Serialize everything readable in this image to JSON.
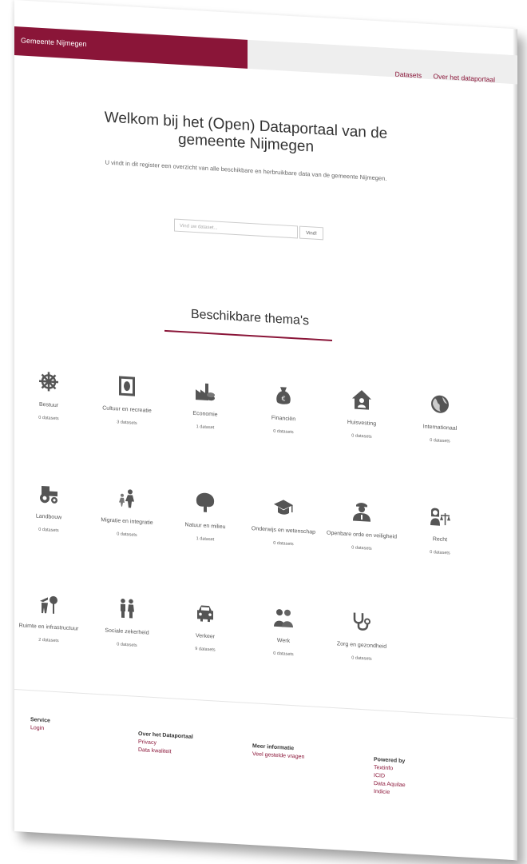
{
  "header": {
    "brand": "Gemeente Nijmegen",
    "nav": [
      "Datasets",
      "Over het dataportaal"
    ]
  },
  "hero": {
    "title": "Welkom bij het (Open) Dataportaal van de gemeente Nijmegen",
    "subtitle": "U vindt in dit register een overzicht van alle beschikbare en herbruikbare data van de gemeente Nijmegen.",
    "search_placeholder": "Vind uw dataset...",
    "search_button": "Vind!"
  },
  "themes": {
    "title": "Beschikbare thema's",
    "items": [
      {
        "label": "Bestuur",
        "count": "0 datasets",
        "icon": "ship-wheel-icon"
      },
      {
        "label": "Cultuur en recreatie",
        "count": "3 datasets",
        "icon": "painting-icon"
      },
      {
        "label": "Economie",
        "count": "1 dataset",
        "icon": "factory-coins-icon"
      },
      {
        "label": "Financiën",
        "count": "0 datasets",
        "icon": "money-bag-icon"
      },
      {
        "label": "Huisvesting",
        "count": "0 datasets",
        "icon": "house-icon"
      },
      {
        "label": "Internationaal",
        "count": "0 datasets",
        "icon": "globe-icon"
      },
      {
        "label": "Landbouw",
        "count": "0 datasets",
        "icon": "tractor-icon"
      },
      {
        "label": "Migratie en integratie",
        "count": "0 datasets",
        "icon": "migration-icon"
      },
      {
        "label": "Natuur en milieu",
        "count": "1 dataset",
        "icon": "tree-icon"
      },
      {
        "label": "Onderwijs en wetenschap",
        "count": "0 datasets",
        "icon": "graduation-cap-icon"
      },
      {
        "label": "Openbare orde en veiligheid",
        "count": "0 datasets",
        "icon": "police-officer-icon"
      },
      {
        "label": "Recht",
        "count": "0 datasets",
        "icon": "judge-scales-icon"
      },
      {
        "label": "Ruimte en infrastructuur",
        "count": "2 datasets",
        "icon": "construction-icon"
      },
      {
        "label": "Sociale zekerheid",
        "count": "0 datasets",
        "icon": "family-icon"
      },
      {
        "label": "Verkeer",
        "count": "9 datasets",
        "icon": "car-icon"
      },
      {
        "label": "Werk",
        "count": "0 datasets",
        "icon": "workers-icon"
      },
      {
        "label": "Zorg en gezondheid",
        "count": "0 datasets",
        "icon": "stethoscope-icon"
      }
    ]
  },
  "footer": {
    "service": {
      "heading": "Service",
      "links": [
        "Login"
      ]
    },
    "over": {
      "heading": "Over het Dataportaal",
      "links": [
        "Privacy",
        "Data kwaliteit"
      ]
    },
    "meer": {
      "heading": "Meer informatie",
      "links": [
        "Veel gestelde vragen"
      ]
    },
    "powered": {
      "heading": "Powered by",
      "links": [
        "Textinfo",
        "ICID",
        "Data Aquilae",
        "Indicie"
      ]
    }
  },
  "colors": {
    "brand": "#8a1538",
    "icon": "#555555"
  }
}
